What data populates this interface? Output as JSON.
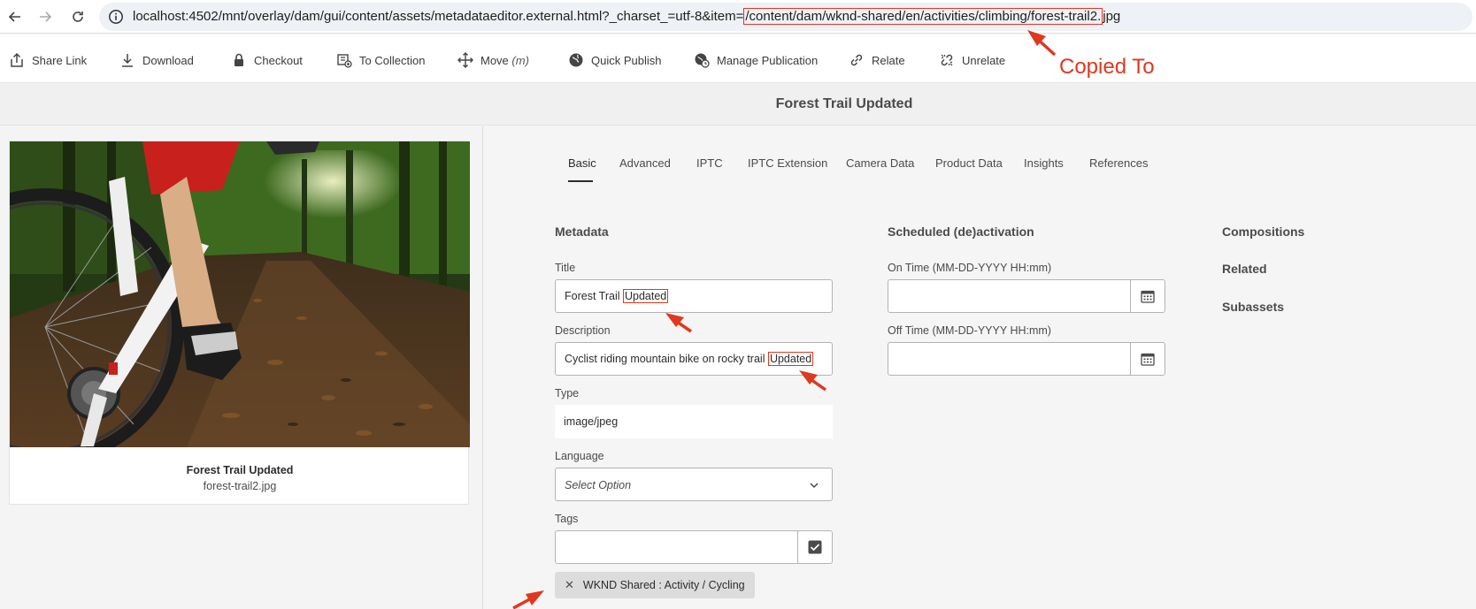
{
  "browser": {
    "url_prefix": "localhost:4502/mnt/overlay/dam/gui/content/assets/metadataeditor.external.html?_charset_=utf-8&item=",
    "url_highlight": "/content/dam/wknd-shared/en/activities/climbing/forest-trail2.",
    "url_suffix": "jpg"
  },
  "actions": [
    {
      "label": "Share Link",
      "icon": "share-icon"
    },
    {
      "label": "Download",
      "icon": "download-icon"
    },
    {
      "label": "Checkout",
      "icon": "lock-icon"
    },
    {
      "label": "To Collection",
      "icon": "collection-add-icon"
    },
    {
      "label": "Move",
      "shortcut": "(m)",
      "icon": "move-icon"
    },
    {
      "label": "Quick Publish",
      "icon": "globe-icon"
    },
    {
      "label": "Manage Publication",
      "icon": "globe-clock-icon"
    },
    {
      "label": "Relate",
      "icon": "link-icon"
    },
    {
      "label": "Unrelate",
      "icon": "unlink-icon"
    }
  ],
  "page_title": "Forest Trail Updated",
  "card": {
    "title": "Forest Trail Updated",
    "filename": "forest-trail2.jpg"
  },
  "tabs": [
    "Basic",
    "Advanced",
    "IPTC",
    "IPTC Extension",
    "Camera Data",
    "Product Data",
    "Insights",
    "References"
  ],
  "metadata": {
    "heading": "Metadata",
    "title_label": "Title",
    "title_value_prefix": "Forest Trail ",
    "title_value_highlight": "Updated",
    "description_label": "Description",
    "description_value_prefix": "Cyclist riding mountain bike on rocky trail ",
    "description_value_highlight": "Updated",
    "type_label": "Type",
    "type_value": "image/jpeg",
    "language_label": "Language",
    "language_placeholder": "Select Option",
    "tags_label": "Tags",
    "tag_chip": "WKND Shared : Activity / Cycling"
  },
  "scheduled": {
    "heading": "Scheduled (de)activation",
    "on_time_label": "On Time (MM-DD-YYYY HH:mm)",
    "off_time_label": "Off Time (MM-DD-YYYY HH:mm)"
  },
  "side_links": [
    "Compositions",
    "Related",
    "Subassets"
  ],
  "annotation": {
    "copied_to": "Copied To",
    "color": "#e0371f"
  }
}
